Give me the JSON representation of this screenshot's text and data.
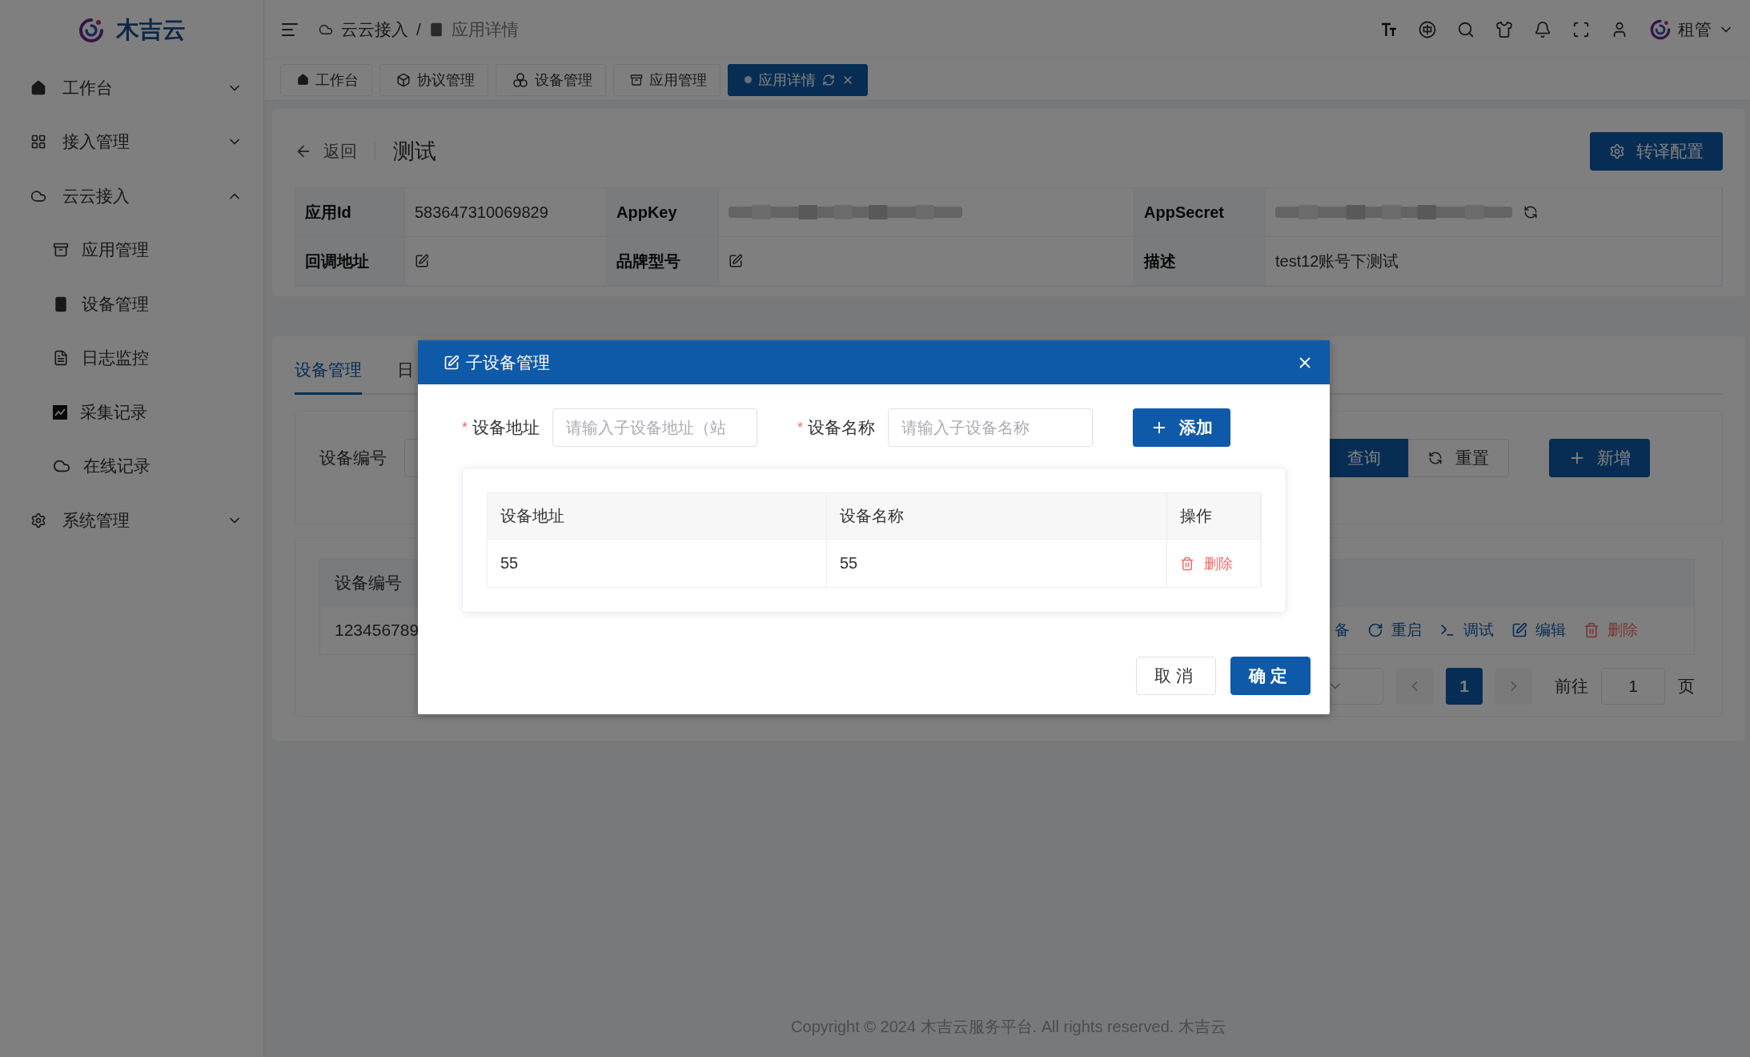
{
  "brand": {
    "name": "木吉云"
  },
  "sidebar": {
    "items": [
      {
        "label": "工作台",
        "expanded": false
      },
      {
        "label": "接入管理",
        "expanded": false
      },
      {
        "label": "云云接入",
        "expanded": true,
        "children": [
          {
            "label": "应用管理"
          },
          {
            "label": "设备管理"
          },
          {
            "label": "日志监控"
          },
          {
            "label": "采集记录"
          },
          {
            "label": "在线记录"
          }
        ]
      },
      {
        "label": "系统管理",
        "expanded": false
      }
    ]
  },
  "header": {
    "breadcrumb": [
      "云云接入",
      "应用详情"
    ],
    "separator": "/",
    "user": "租管"
  },
  "tabs": [
    {
      "label": "工作台",
      "selected": false
    },
    {
      "label": "协议管理",
      "selected": false
    },
    {
      "label": "设备管理",
      "selected": false
    },
    {
      "label": "应用管理",
      "selected": false
    },
    {
      "label": "应用详情",
      "selected": true
    }
  ],
  "page_header": {
    "back": "返回",
    "title": "测试",
    "action": "转译配置"
  },
  "details": [
    {
      "label": "应用Id",
      "kind": "text",
      "value": "583647310069829"
    },
    {
      "label": "AppKey",
      "kind": "redacted"
    },
    {
      "label": "AppSecret",
      "kind": "redacted_refresh"
    },
    {
      "label": "回调地址",
      "kind": "editable"
    },
    {
      "label": "品牌型号",
      "kind": "editable"
    },
    {
      "label": "描述",
      "kind": "text",
      "value": "test12账号下测试"
    }
  ],
  "device_tabs": [
    {
      "label": "设备管理",
      "selected": true
    },
    {
      "label": "日",
      "selected": false
    }
  ],
  "search": {
    "label": "设备编号",
    "query": "查询",
    "reset": "重置",
    "add": "新增"
  },
  "device_table": {
    "columns": [
      "设备编号"
    ],
    "rows": [
      {
        "cell": "123456789",
        "actions": [
          {
            "label": "备",
            "kind": "plain"
          },
          {
            "label": "重启",
            "kind": "restart"
          },
          {
            "label": "调试",
            "kind": "debug"
          },
          {
            "label": "编辑",
            "kind": "edit"
          },
          {
            "label": "删除",
            "kind": "delete"
          }
        ]
      }
    ]
  },
  "pagination": {
    "pages": [
      {
        "label": "1",
        "selected": true
      }
    ],
    "goto_label": "前往",
    "goto_value": "1",
    "goto_suffix": "页"
  },
  "footer": "Copyright © 2024 木吉云服务平台. All rights reserved. 木吉云",
  "dialog": {
    "title": "子设备管理",
    "required_mark": "*",
    "fields": [
      {
        "label": "设备地址",
        "placeholder": "请输入子设备地址（站",
        "required": true
      },
      {
        "label": "设备名称",
        "placeholder": "请输入子设备名称",
        "required": true
      }
    ],
    "add_button": "添加",
    "columns": [
      "设备地址",
      "设备名称",
      "操作"
    ],
    "rows": [
      {
        "cells": [
          "55",
          "55"
        ],
        "action": "删除"
      }
    ],
    "cancel": "取消",
    "confirm": "确定"
  }
}
